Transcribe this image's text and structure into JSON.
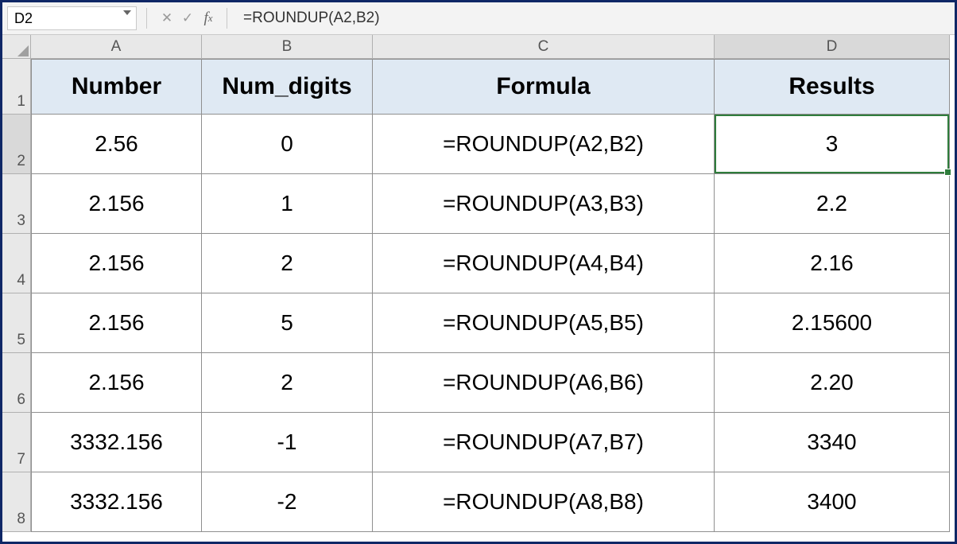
{
  "formula_bar": {
    "cell_ref": "D2",
    "formula": "=ROUNDUP(A2,B2)"
  },
  "columns": [
    "A",
    "B",
    "C",
    "D"
  ],
  "rows": [
    "1",
    "2",
    "3",
    "4",
    "5",
    "6",
    "7",
    "8"
  ],
  "selected_col": "D",
  "selected_row": "2",
  "headers": {
    "col_a": "Number",
    "col_b": "Num_digits",
    "col_c": "Formula",
    "col_d": "Results"
  },
  "data": [
    {
      "a": "2.56",
      "b": "0",
      "c": "=ROUNDUP(A2,B2)",
      "d": "3"
    },
    {
      "a": "2.156",
      "b": "1",
      "c": "=ROUNDUP(A3,B3)",
      "d": "2.2"
    },
    {
      "a": "2.156",
      "b": "2",
      "c": "=ROUNDUP(A4,B4)",
      "d": "2.16"
    },
    {
      "a": "2.156",
      "b": "5",
      "c": "=ROUNDUP(A5,B5)",
      "d": "2.15600"
    },
    {
      "a": "2.156",
      "b": "2",
      "c": "=ROUNDUP(A6,B6)",
      "d": "2.20"
    },
    {
      "a": "3332.156",
      "b": "-1",
      "c": "=ROUNDUP(A7,B7)",
      "d": "3340"
    },
    {
      "a": "3332.156",
      "b": "-2",
      "c": "=ROUNDUP(A8,B8)",
      "d": "3400"
    }
  ]
}
